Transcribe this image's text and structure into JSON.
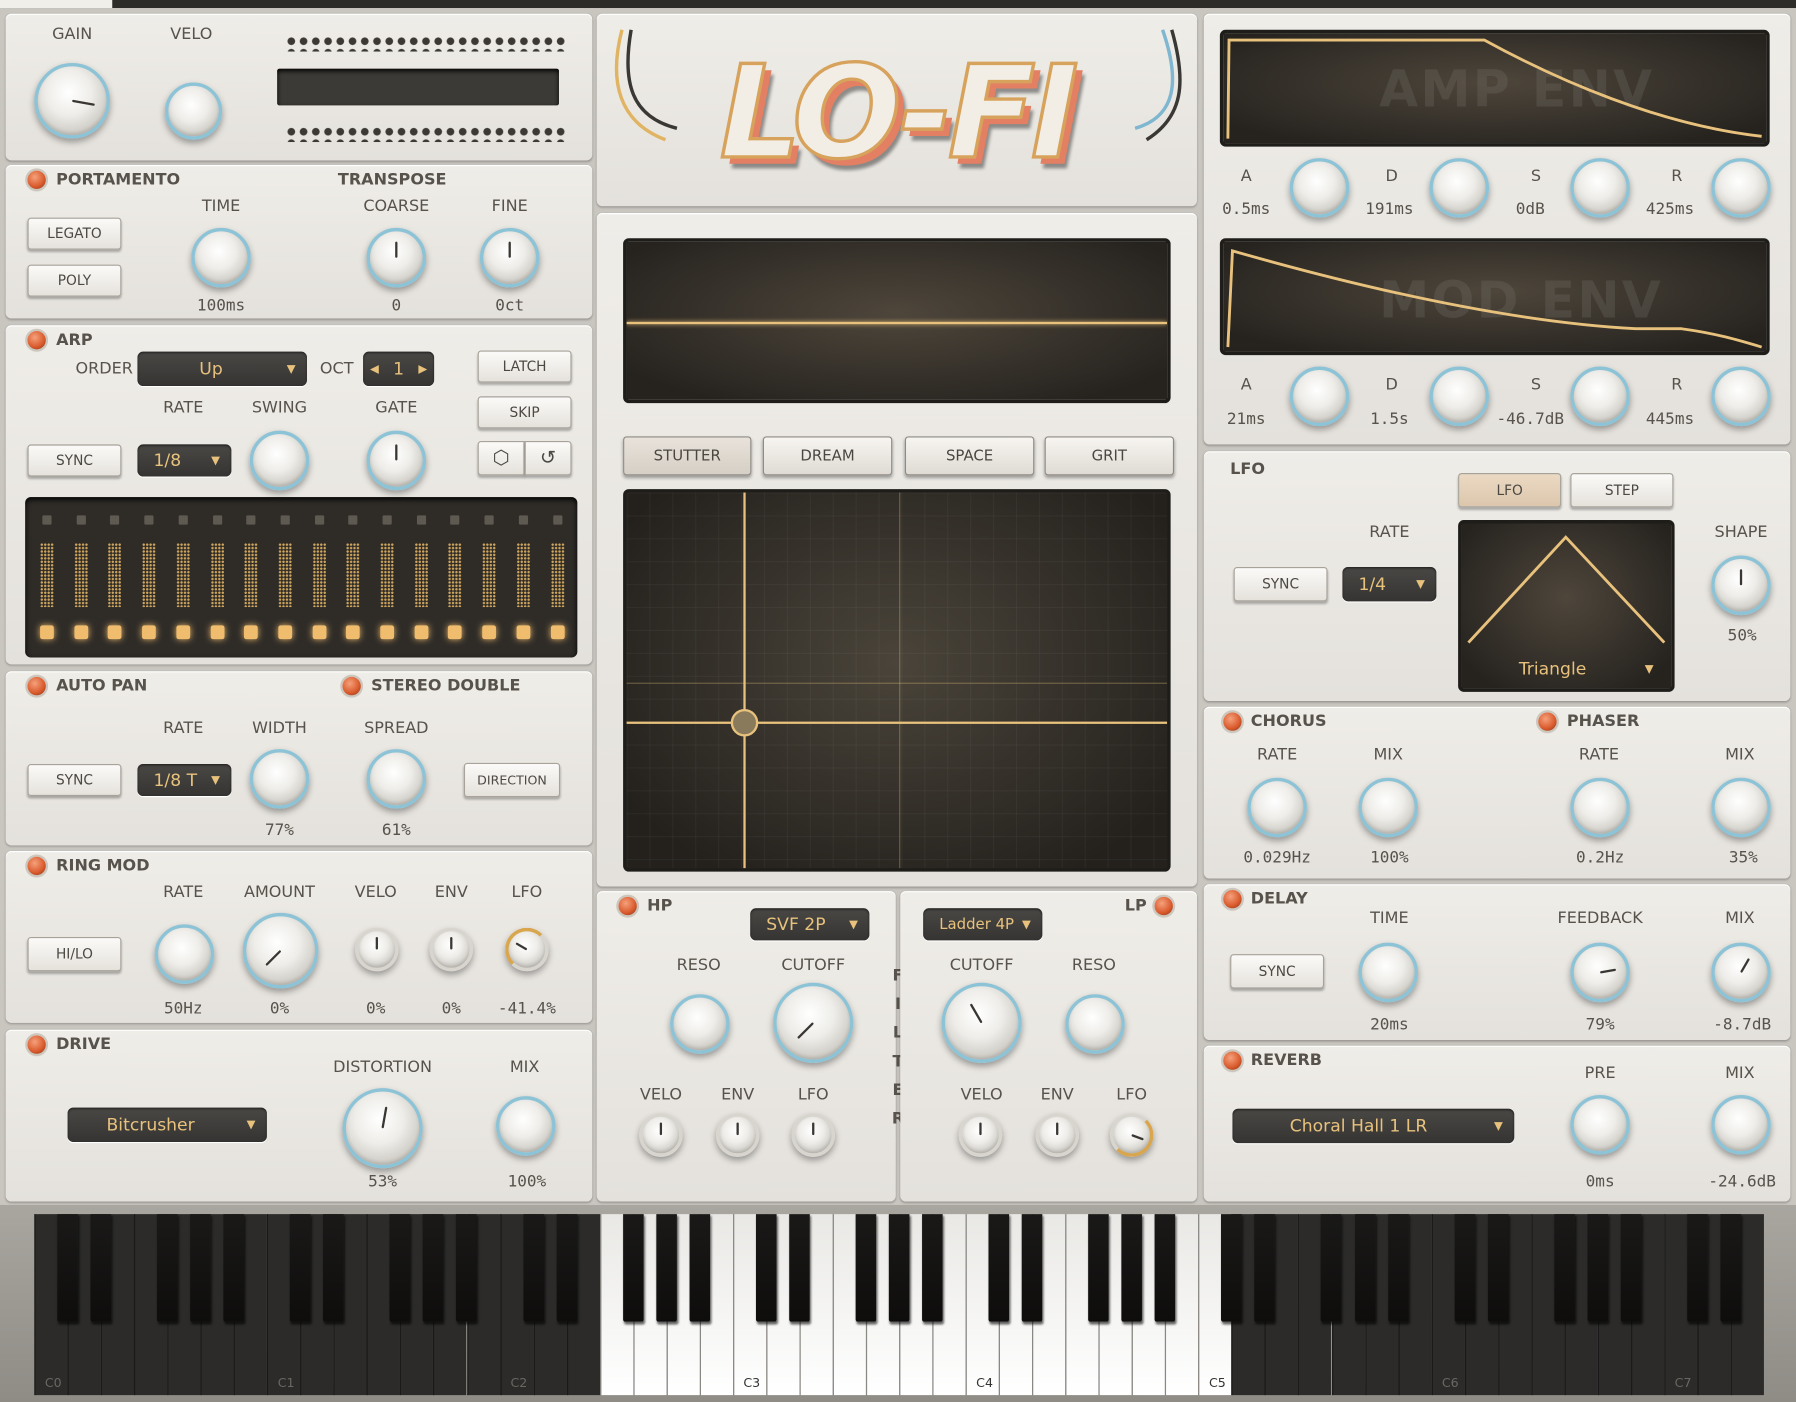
{
  "window": {
    "logo": "LO-FI"
  },
  "colors": {
    "accent_led": "#d9592b",
    "knob_ring": "#8cc3d6",
    "screen_line": "#e8c27d"
  },
  "top": {
    "gain_label": "GAIN",
    "velo_label": "VELO"
  },
  "portamento": {
    "title": "PORTAMENTO",
    "legato": "LEGATO",
    "poly": "POLY",
    "time_label": "TIME",
    "time_value": "100ms",
    "transpose_title": "TRANSPOSE",
    "coarse_label": "COARSE",
    "coarse_value": "0",
    "fine_label": "FINE",
    "fine_value": "0ct"
  },
  "arp": {
    "title": "ARP",
    "order_label": "ORDER",
    "order_value": "Up",
    "oct_label": "OCT",
    "oct_value": "1",
    "latch": "LATCH",
    "skip": "SKIP",
    "rate_label": "RATE",
    "swing_label": "SWING",
    "gate_label": "GATE",
    "sync": "SYNC",
    "rate_value": "1/8",
    "dice_icon": "dice-icon",
    "reset_icon": "undo-icon"
  },
  "autopan": {
    "title": "AUTO PAN",
    "rate_label": "RATE",
    "width_label": "WIDTH",
    "sync": "SYNC",
    "rate_value": "1/8 T",
    "width_value": "77%"
  },
  "stereo": {
    "title": "STEREO DOUBLE",
    "spread_label": "SPREAD",
    "spread_value": "61%",
    "direction": "DIRECTION"
  },
  "ringmod": {
    "title": "RING MOD",
    "hilo": "HI/LO",
    "rate_label": "RATE",
    "rate_value": "50Hz",
    "amount_label": "AMOUNT",
    "amount_value": "0%",
    "velo_label": "VELO",
    "velo_value": "0%",
    "env_label": "ENV",
    "env_value": "0%",
    "lfo_label": "LFO",
    "lfo_value": "-41.4%"
  },
  "drive": {
    "title": "DRIVE",
    "type_value": "Bitcrusher",
    "distortion_label": "DISTORTION",
    "distortion_value": "53%",
    "mix_label": "MIX",
    "mix_value": "100%"
  },
  "fx": {
    "tabs": [
      "STUTTER",
      "DREAM",
      "SPACE",
      "GRIT"
    ],
    "active": "STUTTER"
  },
  "filter": {
    "hp_title": "HP",
    "lp_title": "LP",
    "hp_type": "SVF 2P",
    "lp_type": "Ladder 4P",
    "reso_label": "RESO",
    "cutoff_label": "CUTOFF",
    "velo_label": "VELO",
    "env_label": "ENV",
    "lfo_label": "LFO",
    "vertical": "FILTER"
  },
  "ampenv": {
    "title": "AMP ENV",
    "a_label": "A",
    "a_value": "0.5ms",
    "d_label": "D",
    "d_value": "191ms",
    "s_label": "S",
    "s_value": "0dB",
    "r_label": "R",
    "r_value": "425ms"
  },
  "modenv": {
    "title": "MOD ENV",
    "a_label": "A",
    "a_value": "21ms",
    "d_label": "D",
    "d_value": "1.5s",
    "s_label": "S",
    "s_value": "-46.7dB",
    "r_label": "R",
    "r_value": "445ms"
  },
  "lfo": {
    "title": "LFO",
    "tab_lfo": "LFO",
    "tab_step": "STEP",
    "rate_label": "RATE",
    "sync": "SYNC",
    "rate_value": "1/4",
    "shape_label": "SHAPE",
    "shape_value": "50%",
    "waveform": "Triangle"
  },
  "chorus": {
    "title": "CHORUS",
    "rate_label": "RATE",
    "rate_value": "0.029Hz",
    "mix_label": "MIX",
    "mix_value": "100%"
  },
  "phaser": {
    "title": "PHASER",
    "rate_label": "RATE",
    "rate_value": "0.2Hz",
    "mix_label": "MIX",
    "mix_value": "35%"
  },
  "delay": {
    "title": "DELAY",
    "sync": "SYNC",
    "time_label": "TIME",
    "time_value": "20ms",
    "feedback_label": "FEEDBACK",
    "feedback_value": "79%",
    "mix_label": "MIX",
    "mix_value": "-8.7dB"
  },
  "reverb": {
    "title": "REVERB",
    "type_value": "Choral Hall 1 LR",
    "pre_label": "PRE",
    "pre_value": "0ms",
    "mix_label": "MIX",
    "mix_value": "-24.6dB"
  },
  "keyboard": {
    "labels": [
      "C0",
      "C1",
      "C2",
      "C3",
      "C4",
      "C5",
      "C6",
      "C7"
    ]
  }
}
